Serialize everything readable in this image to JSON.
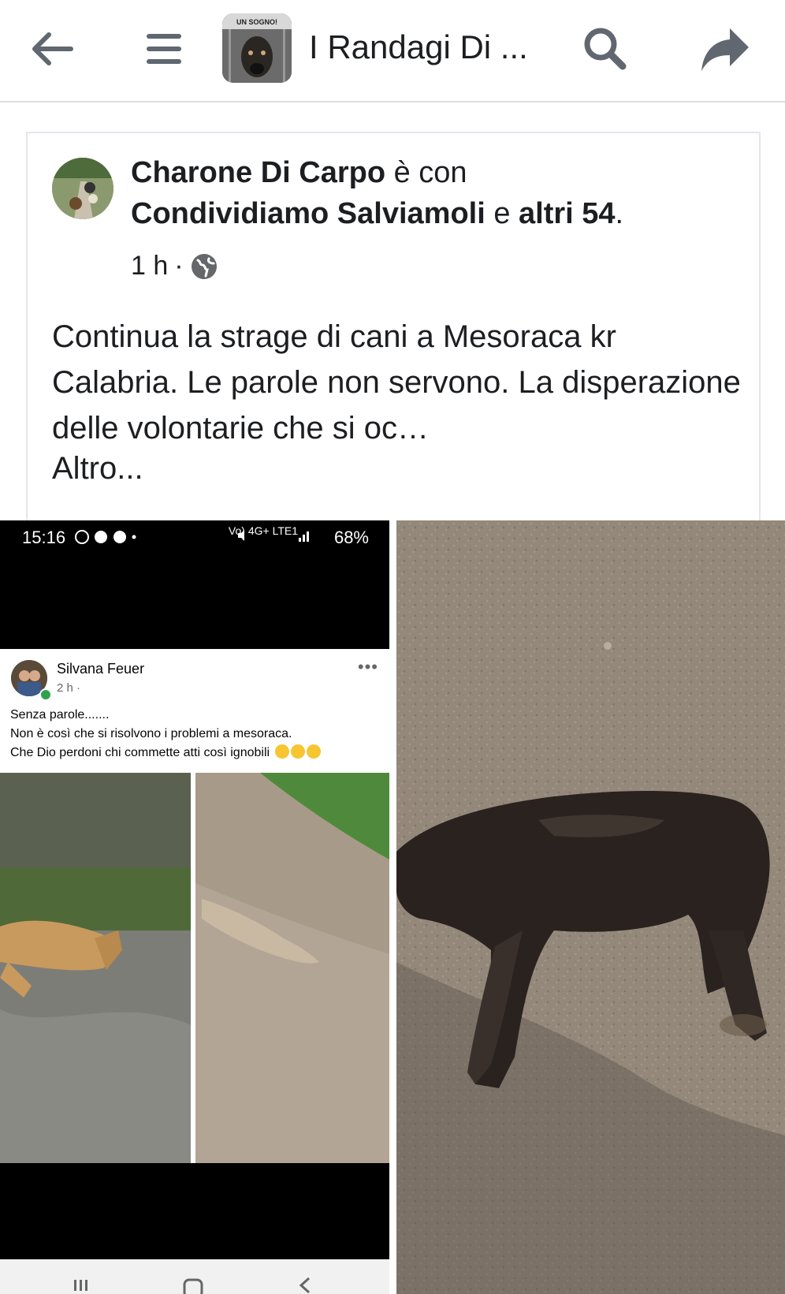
{
  "topbar": {
    "group_title": "I Randagi Di ...",
    "avatar_banner": "UN SOGNO!",
    "icons": [
      "back-arrow-icon",
      "menu-icon",
      "search-icon",
      "share-icon"
    ]
  },
  "post": {
    "author": "Charone Di Carpo",
    "with_text": " è con",
    "tagged": "Condividiamo Salviamoli",
    "and_text": " e ",
    "others": "altri 54",
    "period": ".",
    "time": "1 h",
    "separator": "·",
    "privacy_icon": "globe-icon",
    "text": "Continua la strage di cani a Mesoraca kr Calabria. Le parole non servono. La disperazione delle volontarie che si oc…",
    "see_more": "Altro..."
  },
  "screenshot": {
    "status_time": "15:16",
    "status_network": "Vo) 4G+ LTE1",
    "battery": "68%",
    "inner_author": "Silvana Feuer",
    "inner_time": "2 h ·",
    "inner_text_1": "Senza parole.......",
    "inner_text_2": "Non è così che si risolvono i problemi a mesoraca.",
    "inner_text_3": "Che Dio perdoni chi commette atti così ignobili",
    "more_label": "•••"
  },
  "colors": {
    "text": "#1c1e21",
    "icon": "#606770",
    "divider": "#dadde1",
    "online": "#31a24c"
  }
}
